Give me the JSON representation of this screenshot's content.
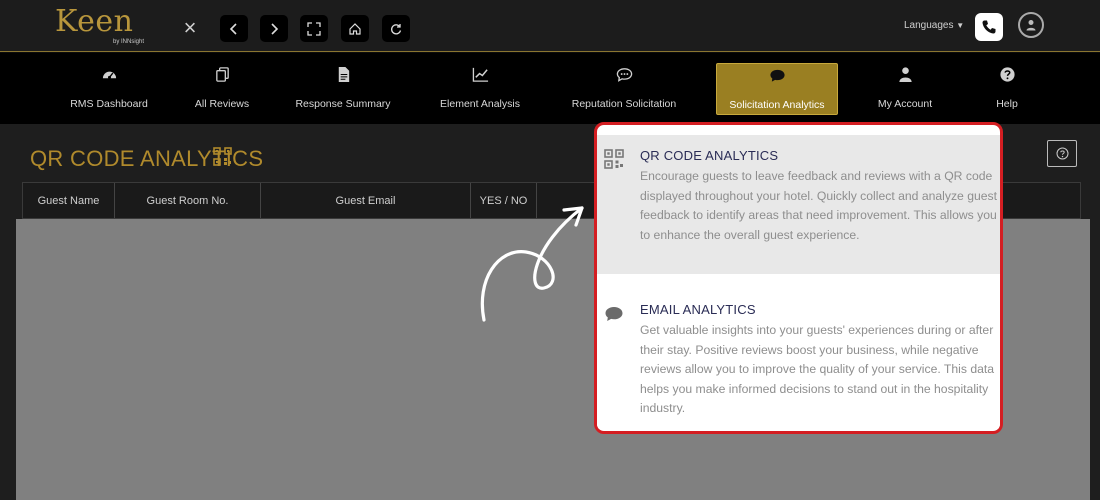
{
  "brand": {
    "name": "Keen",
    "tagline": "by INNsight",
    "gold": "#b8963c"
  },
  "topbar": {
    "languages_label": "Languages",
    "buttons": [
      "back-icon",
      "forward-icon",
      "expand-icon",
      "home-icon",
      "refresh-icon"
    ]
  },
  "nav": {
    "items": [
      {
        "label": "RMS Dashboard",
        "icon": "dashboard-icon"
      },
      {
        "label": "All Reviews",
        "icon": "reviews-icon"
      },
      {
        "label": "Response Summary",
        "icon": "document-icon"
      },
      {
        "label": "Element Analysis",
        "icon": "chart-icon"
      },
      {
        "label": "Reputation Solicitation",
        "icon": "chat-dots-icon"
      },
      {
        "label": "Solicitation Analytics",
        "icon": "chat-bubble-icon",
        "active": true
      },
      {
        "label": "My Account",
        "icon": "user-icon"
      },
      {
        "label": "Help",
        "icon": "question-icon"
      }
    ],
    "active_color": "#9a7f22"
  },
  "page": {
    "title": "QR CODE ANALYTICS",
    "table": {
      "columns": [
        "Guest Name",
        "Guest Room No.",
        "Guest Email",
        "YES / NO"
      ]
    }
  },
  "popup": {
    "border_color": "#d41e22",
    "qr": {
      "title": "QR CODE ANALYTICS",
      "description": "Encourage guests to leave feedback and reviews with a QR code displayed throughout your hotel. Quickly collect and analyze guest feedback to identify areas that need improvement. This allows you to enhance the overall guest experience."
    },
    "email": {
      "title": "EMAIL ANALYTICS",
      "description": "Get valuable insights into your guests' experiences during or after their stay. Positive reviews boost your business, while negative reviews allow you to improve the quality of your service. This data helps you make informed decisions to stand out in the hospitality industry."
    }
  }
}
